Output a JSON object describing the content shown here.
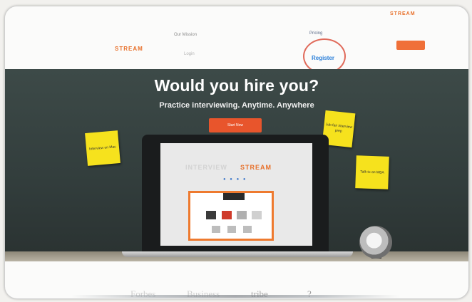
{
  "header": {
    "logo_left": "STREAM",
    "logo_right": "STREAM",
    "nav": [
      "Our Mission",
      "Login",
      "Pricing"
    ],
    "register_link": "Register",
    "accent_color": "#e8702a"
  },
  "hero": {
    "headline": "Would you hire you?",
    "subheadline": "Practice interviewing. Anytime. Anywhere",
    "cta_label": "Start Now",
    "sticky_notes": [
      {
        "text": "Interview on Mac"
      },
      {
        "text": "Job fair interview prep"
      },
      {
        "text": "Talk to an MBA"
      }
    ]
  },
  "laptop_screen": {
    "logo": "STREAM",
    "logo_prefix": "INTERVIEW"
  },
  "footer": {
    "logos": [
      "Forbes",
      "Business",
      "tribe",
      "?"
    ]
  }
}
